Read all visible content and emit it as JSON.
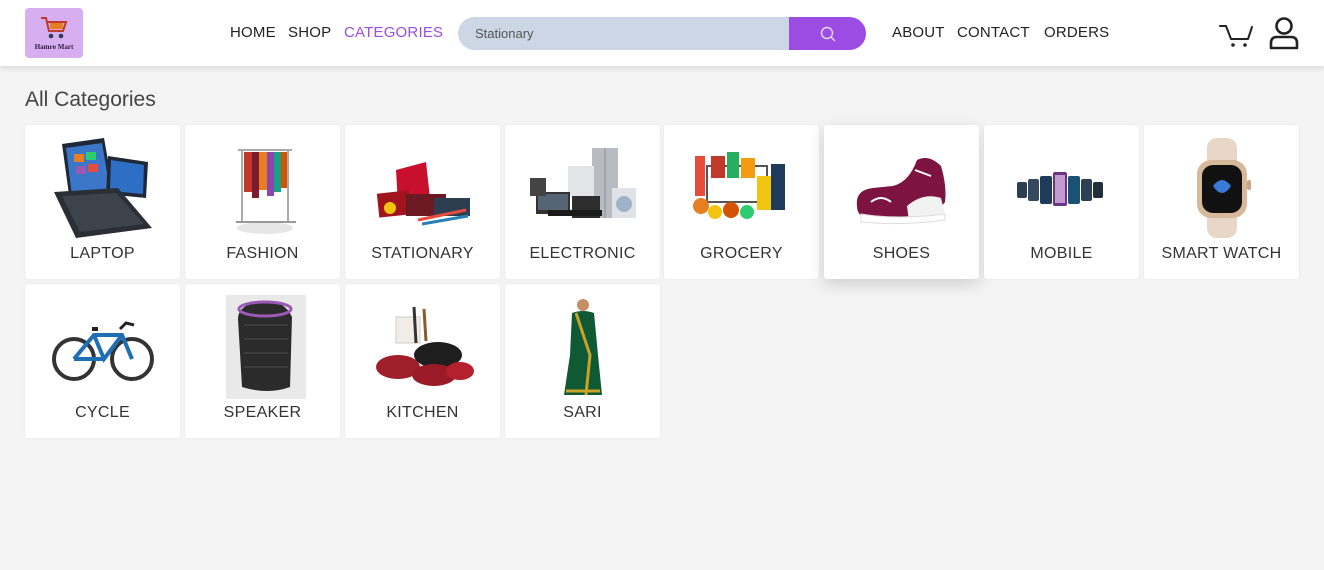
{
  "brand": {
    "logo_text": "Hamro Mart"
  },
  "nav": {
    "home": "HOME",
    "shop": "SHOP",
    "categories": "CATEGORIES",
    "about": "ABOUT",
    "contact": "CONTACT",
    "orders": "ORDERS",
    "active_color": "#9b4de3"
  },
  "search": {
    "value": "Stationary",
    "icon": "search-icon",
    "button_color": "#9b4de3"
  },
  "header_icons": {
    "cart": "cart-icon",
    "user": "user-icon"
  },
  "page": {
    "heading": "All Categories"
  },
  "categories": [
    {
      "label": "LAPTOP",
      "icon": "laptop-image"
    },
    {
      "label": "FASHION",
      "icon": "clothes-rack-image"
    },
    {
      "label": "STATIONARY",
      "icon": "stationary-image"
    },
    {
      "label": "ELECTRONIC",
      "icon": "appliances-image"
    },
    {
      "label": "GROCERY",
      "icon": "grocery-image"
    },
    {
      "label": "SHOES",
      "icon": "shoe-image"
    },
    {
      "label": "MOBILE",
      "icon": "phones-image"
    },
    {
      "label": "SMART WATCH",
      "icon": "watch-image"
    },
    {
      "label": "CYCLE",
      "icon": "bicycle-image"
    },
    {
      "label": "SPEAKER",
      "icon": "speaker-image"
    },
    {
      "label": "KITCHEN",
      "icon": "cookware-image"
    },
    {
      "label": "SARI",
      "icon": "sari-image"
    }
  ]
}
